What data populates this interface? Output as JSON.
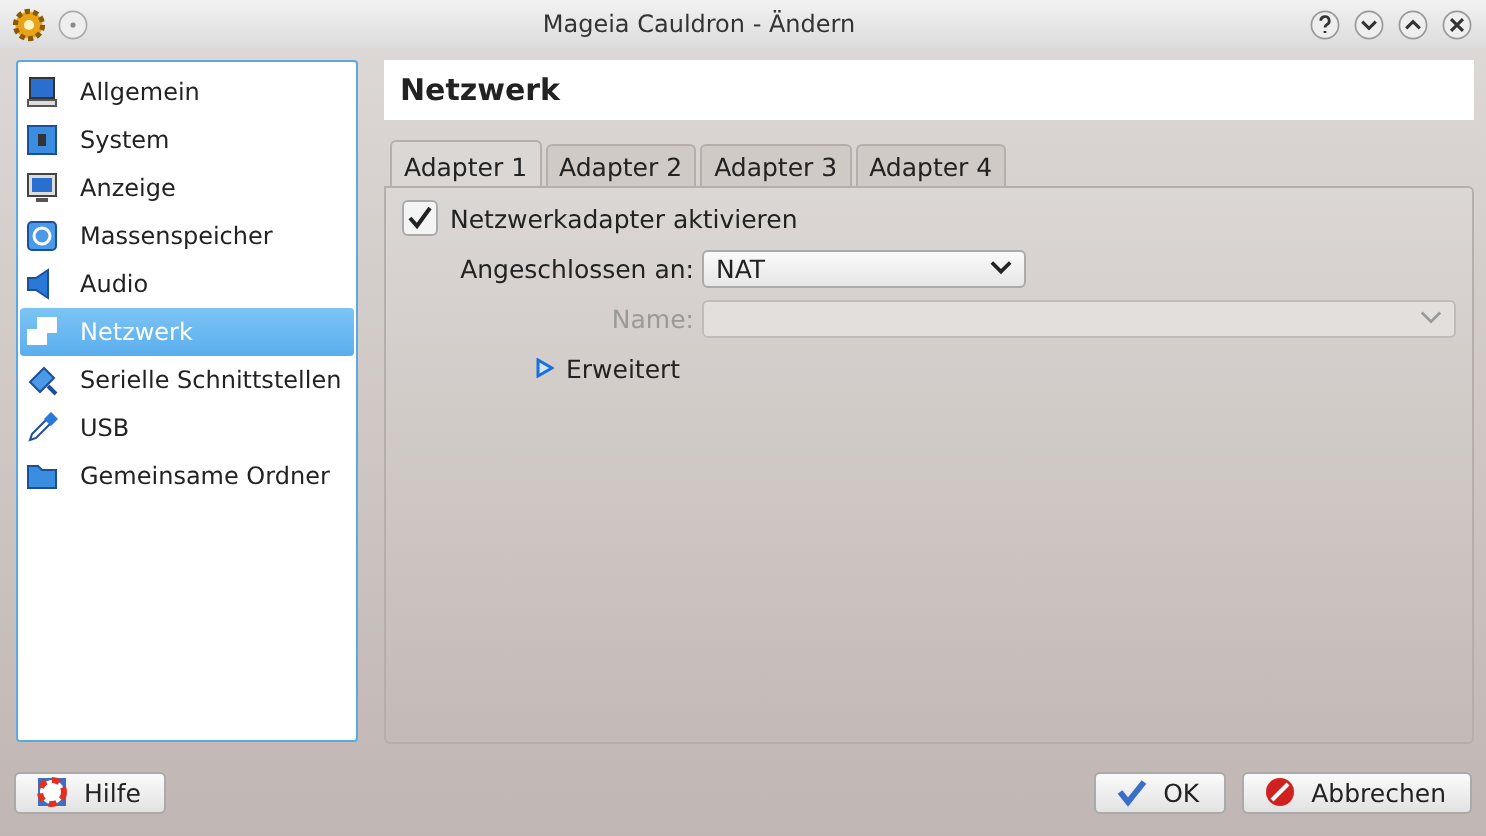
{
  "window": {
    "title": "Mageia Cauldron - Ändern"
  },
  "sidebar": {
    "items": [
      {
        "label": "Allgemein",
        "selected": false
      },
      {
        "label": "System",
        "selected": false
      },
      {
        "label": "Anzeige",
        "selected": false
      },
      {
        "label": "Massenspeicher",
        "selected": false
      },
      {
        "label": "Audio",
        "selected": false
      },
      {
        "label": "Netzwerk",
        "selected": true
      },
      {
        "label": "Serielle Schnittstellen",
        "selected": false
      },
      {
        "label": "USB",
        "selected": false
      },
      {
        "label": "Gemeinsame Ordner",
        "selected": false
      }
    ]
  },
  "page": {
    "title": "Netzwerk"
  },
  "tabs": [
    {
      "label": "Adapter 1",
      "selected": true
    },
    {
      "label": "Adapter 2",
      "selected": false
    },
    {
      "label": "Adapter 3",
      "selected": false
    },
    {
      "label": "Adapter 4",
      "selected": false
    }
  ],
  "adapter": {
    "enable": {
      "label": "Netzwerkadapter aktivieren",
      "checked": true
    },
    "attached": {
      "label": "Angeschlossen an:",
      "value": "NAT"
    },
    "name": {
      "label": "Name:",
      "disabled": true
    },
    "advanced": {
      "label": "Erweitert",
      "expanded": false
    }
  },
  "buttons": {
    "help": "Hilfe",
    "ok": "OK",
    "cancel": "Abbrechen"
  }
}
